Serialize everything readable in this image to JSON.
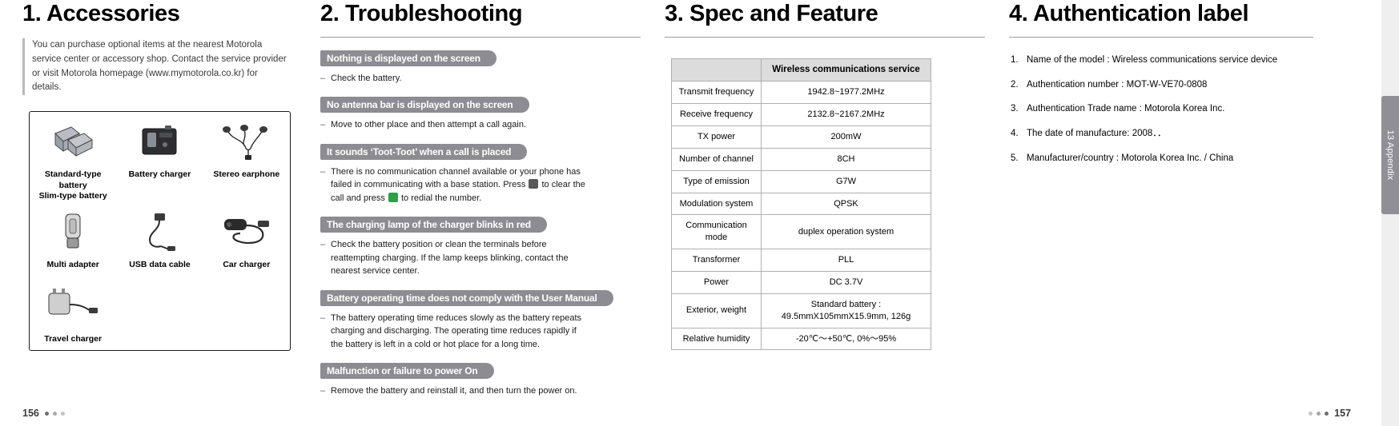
{
  "columns": {
    "accessories": {
      "title": "1. Accessories",
      "intro": "You can purchase optional items at the nearest Motorola service center or accessory shop. Contact the service provider or visit Motorola homepage (www.mymotorola.co.kr) for details.",
      "items": [
        {
          "label": "Standard-type battery\nSlim-type battery",
          "icon": "battery-icon"
        },
        {
          "label": "Battery charger",
          "icon": "battery-charger-icon"
        },
        {
          "label": "Stereo earphone",
          "icon": "stereo-earphone-icon"
        },
        {
          "label": "Multi adapter",
          "icon": "multi-adapter-icon"
        },
        {
          "label": "USB data cable",
          "icon": "usb-data-cable-icon"
        },
        {
          "label": "Car charger",
          "icon": "car-charger-icon"
        },
        {
          "label": "Travel charger",
          "icon": "travel-charger-icon"
        }
      ]
    },
    "troubleshooting": {
      "title": "2. Troubleshooting",
      "entries": [
        {
          "heading": "Nothing is displayed on the screen",
          "body": "Check the battery."
        },
        {
          "heading": "No antenna bar is displayed on the screen",
          "body": "Move to other place and then attempt a call again."
        },
        {
          "heading": "It sounds ‘Toot-Toot’ when a call is placed",
          "body_pre": "There is no communication channel available or your phone has failed in communicating with a base station. Press ",
          "body_mid": " to clear the call and press ",
          "body_post": " to redial the number."
        },
        {
          "heading": "The charging lamp of the charger blinks in red",
          "body": "Check the battery position or clean the terminals before reattempting charging. If the lamp keeps blinking, contact the nearest service center."
        },
        {
          "heading": "Battery operating time does not comply with the User Manual",
          "body": "The battery operating time reduces slowly as the battery repeats charging and discharging. The operating time reduces rapidly if the battery is left in a cold or hot place for a long time."
        },
        {
          "heading": "Malfunction or failure to power On",
          "body": "Remove the battery and reinstall it, and then turn the power on."
        }
      ]
    },
    "spec": {
      "title": "3. Spec and Feature",
      "table": {
        "headers": [
          "",
          "Wireless communications service"
        ],
        "rows": [
          [
            "Transmit frequency",
            "1942.8~1977.2MHz"
          ],
          [
            "Receive frequency",
            "2132.8~2167.2MHz"
          ],
          [
            "TX power",
            "200mW"
          ],
          [
            "Number of channel",
            "8CH"
          ],
          [
            "Type of emission",
            "G7W"
          ],
          [
            "Modulation system",
            "QPSK"
          ],
          [
            "Communication mode",
            "duplex operation system"
          ],
          [
            "Transformer",
            "PLL"
          ],
          [
            "Power",
            "DC 3.7V"
          ],
          [
            "Exterior, weight",
            "Standard battery : 49.5mmX105mmX15.9mm, 126g"
          ],
          [
            "Relative humidity",
            "-20℃～+50℃, 0%～95%"
          ]
        ]
      }
    },
    "authentication": {
      "title": "4. Authentication label",
      "items": [
        {
          "num": "1.",
          "text": "Name of the model : Wireless communications service device"
        },
        {
          "num": "2.",
          "text": "Authentication number : MOT-W-VE70-0808"
        },
        {
          "num": "3.",
          "text": "Authentication Trade name : Motorola Korea Inc."
        },
        {
          "num": "4.",
          "text": "The date of manufacture: 2008．．"
        },
        {
          "num": "5.",
          "text": "Manufacturer/country : Motorola Korea Inc. / China"
        }
      ]
    }
  },
  "side_tab": "13 Appendix",
  "footer": {
    "left_page": "156",
    "right_page": "157"
  }
}
